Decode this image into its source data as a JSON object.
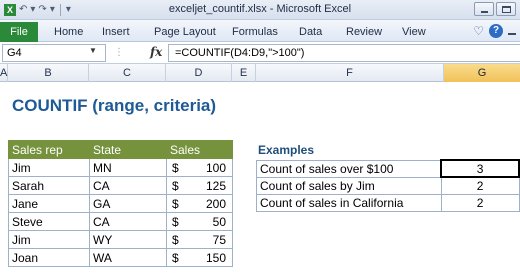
{
  "window": {
    "title": "exceljet_countif.xlsx - Microsoft Excel",
    "qat_icons": [
      "excel-icon",
      "undo-icon",
      "redo-icon",
      "customize-qat-icon"
    ]
  },
  "ribbon": {
    "file_tab": "File",
    "tabs": [
      "Home",
      "Insert",
      "Page Layout",
      "Formulas",
      "Data",
      "Review",
      "View"
    ],
    "file_tab_color": "#2a8a3a"
  },
  "formula_bar": {
    "name_box": "G4",
    "fx_label": "fx",
    "formula": "=COUNTIF(D4:D9,\">100\")"
  },
  "columns": [
    "A",
    "B",
    "C",
    "D",
    "E",
    "F",
    "G"
  ],
  "selected_column": "G",
  "sheet": {
    "title": "COUNTIF (range, criteria)",
    "title_color": "#1f5a96",
    "table_header_color": "#76923c",
    "headers": [
      "Sales rep",
      "State",
      "Sales"
    ],
    "rows": [
      {
        "rep": "Jim",
        "state": "MN",
        "currency": "$",
        "amount": "100"
      },
      {
        "rep": "Sarah",
        "state": "CA",
        "currency": "$",
        "amount": "125"
      },
      {
        "rep": "Jane",
        "state": "GA",
        "currency": "$",
        "amount": "200"
      },
      {
        "rep": "Steve",
        "state": "CA",
        "currency": "$",
        "amount": "50"
      },
      {
        "rep": "Jim",
        "state": "WY",
        "currency": "$",
        "amount": "75"
      },
      {
        "rep": "Joan",
        "state": "WA",
        "currency": "$",
        "amount": "150"
      }
    ],
    "examples_title": "Examples",
    "examples": [
      {
        "label": "Count of sales over $100",
        "result": "3"
      },
      {
        "label": "Count of sales by Jim",
        "result": "2"
      },
      {
        "label": "Count of sales in California",
        "result": "2"
      }
    ]
  }
}
